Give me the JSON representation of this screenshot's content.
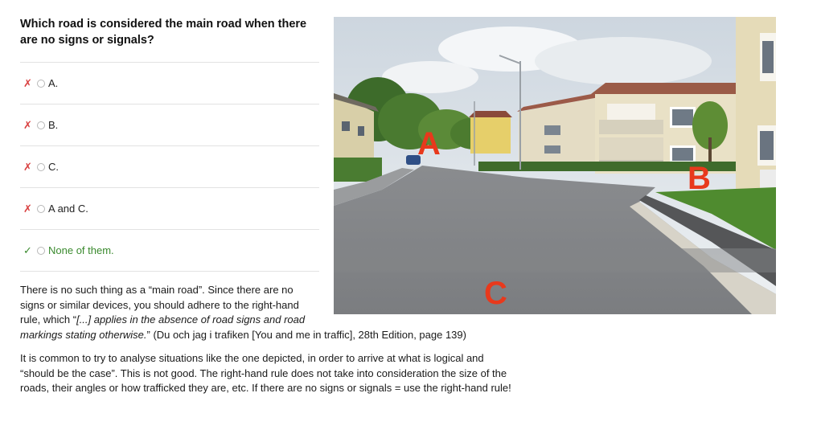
{
  "question": "Which road is considered the main road when there are no signs or signals?",
  "options": [
    {
      "mark": "✗",
      "label": "A.",
      "correct": false
    },
    {
      "mark": "✗",
      "label": "B.",
      "correct": false
    },
    {
      "mark": "✗",
      "label": "C.",
      "correct": false
    },
    {
      "mark": "✗",
      "label": "A and C.",
      "correct": false
    },
    {
      "mark": "✓",
      "label": "None of them.",
      "correct": true
    }
  ],
  "photo": {
    "label_a": "A",
    "label_b": "B",
    "label_c": "C"
  },
  "explanation": {
    "p1_line1": "There is no such thing as a “main road”. Since there are no",
    "p1_line2": "signs or similar devices, you should adhere to the right-hand",
    "p1_line3_pre": "rule, which “",
    "p1_line3_em": "[...] applies in the absence of road signs and road",
    "p1_line4_em": "markings stating otherwise.",
    "p1_line4_post": "” (Du och jag i trafiken [You and me in traffic], 28th Edition, page 139)",
    "p2": "It is common to try to analyse situations like the one depicted, in order to arrive at what is logical and “should be the case”. This is not good. The right-hand rule does not take into consideration the size of the roads, their angles or how trafficked they are, etc. If there are no signs or signals = use the right-hand rule!"
  },
  "colors": {
    "wrong": "#d94040",
    "correct": "#3a8a2e",
    "photo_letters": "#e8391c"
  }
}
